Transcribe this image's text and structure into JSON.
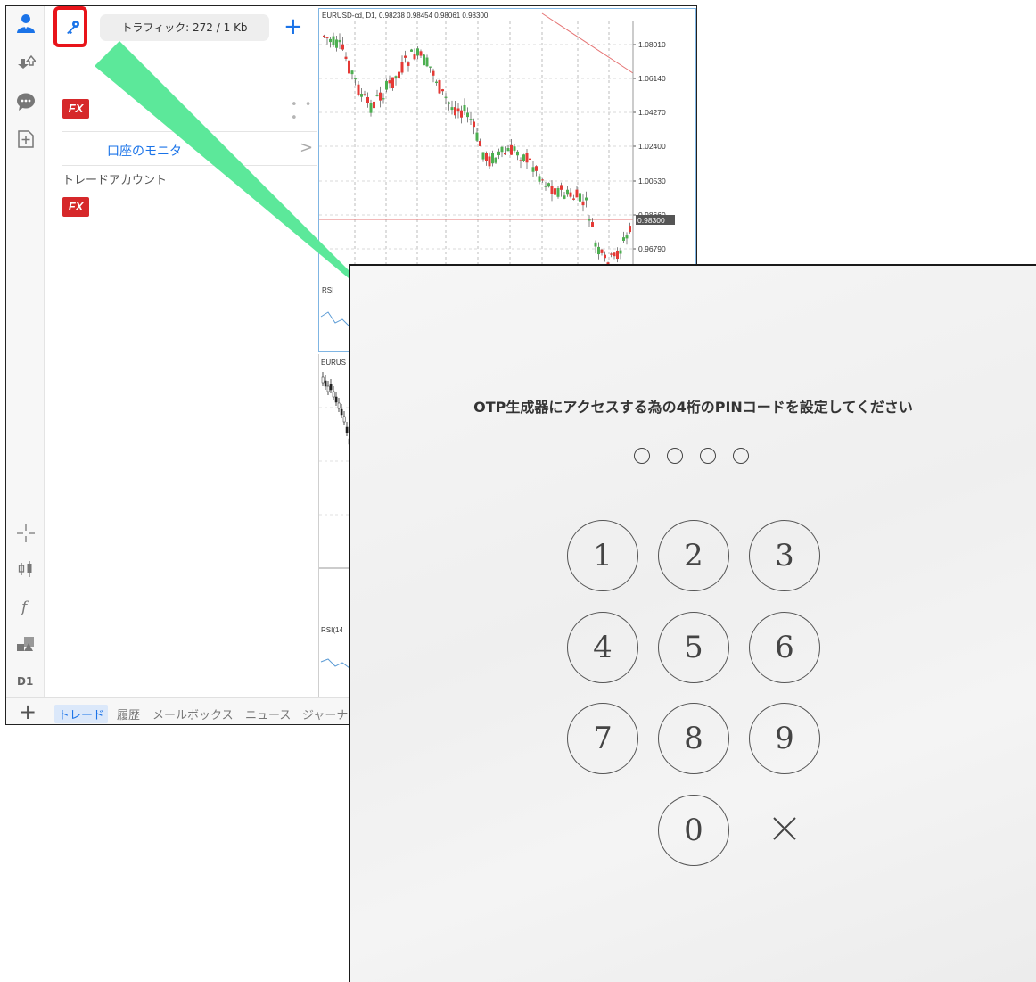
{
  "app": {
    "traffic_label": "トラフィック: 272 / 1 Kb",
    "add_label": "+",
    "fx_logo_text": "FX",
    "more_dots": "• • •",
    "monitor_label": "口座のモニタ",
    "monitor_chevron": ">",
    "trade_accounts_label": "トレードアカウント",
    "timeframe": "D1",
    "bottom_plus": "+",
    "tabs": [
      "トレード",
      "履歴",
      "メールボックス",
      "ニュース",
      "ジャーナル"
    ],
    "accent_color": "#1a73e8",
    "highlight_color": "#e8141a"
  },
  "chart_top": {
    "header": "EURUSD-cd, D1, 0.98238 0.98454 0.98061 0.98300",
    "price_labels": [
      "1.08010",
      "1.06140",
      "1.04270",
      "1.02400",
      "1.00530",
      "0.98660",
      "0.98300",
      "0.96790"
    ],
    "current_price": "0.98300",
    "sub_label": "RSI",
    "bull_color": "#4caf50",
    "bear_color": "#e53935"
  },
  "chart_bottom": {
    "header": "EURUS",
    "sub_label": "RSI(14"
  },
  "arrow_color": "#5ce89a",
  "pin": {
    "title": "OTP生成器にアクセスする為の4桁のPINコードを設定してください",
    "dot_count": 4,
    "keys": [
      "1",
      "2",
      "3",
      "4",
      "5",
      "6",
      "7",
      "8",
      "9",
      "0"
    ]
  }
}
